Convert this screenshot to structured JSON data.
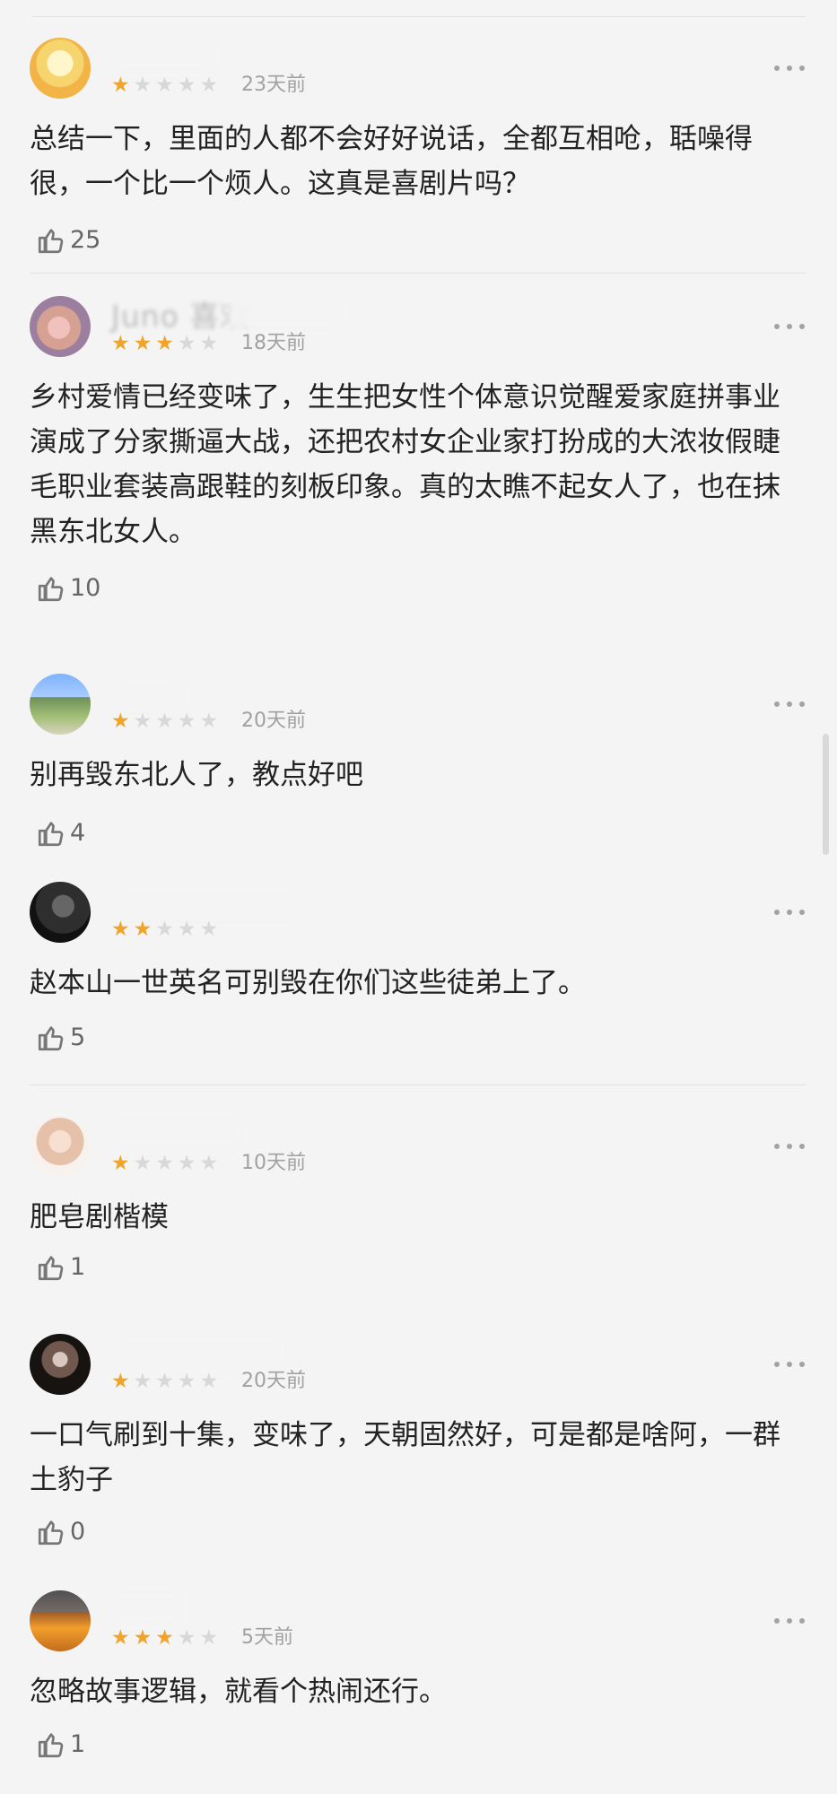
{
  "reviews": [
    {
      "name": "",
      "time": "23天前",
      "rating": 1,
      "text": "总结一下，里面的人都不会好好说话，全都互相呛，聒噪得很，一个比一个烦人。这真是喜剧片吗？",
      "likes": "25"
    },
    {
      "name": "Juno 喜欢",
      "time": "18天前",
      "rating": 3,
      "text": "乡村爱情已经变味了，生生把女性个体意识觉醒爱家庭拼事业演成了分家撕逼大战，还把农村女企业家打扮成的大浓妆假睫毛职业套装高跟鞋的刻板印象。真的太瞧不起女人了，也在抹黑东北女人。",
      "likes": "10"
    },
    {
      "name": "",
      "time": "20天前",
      "rating": 1,
      "text": "别再毁东北人了，教点好吧",
      "likes": "4"
    },
    {
      "name": "",
      "time": "",
      "rating": 2,
      "text": "赵本山一世英名可别毁在你们这些徒弟上了。",
      "likes": "5"
    },
    {
      "name": "",
      "time": "10天前",
      "rating": 1,
      "text": "肥皂剧楷模",
      "likes": "1"
    },
    {
      "name": "",
      "time": "20天前",
      "rating": 1,
      "text": "一口气刷到十集，变味了，天朝固然好，可是都是啥阿，一群土豹子",
      "likes": "0"
    },
    {
      "name": "",
      "time": "5天前",
      "rating": 3,
      "text": "忽略故事逻辑，就看个热闹还行。",
      "likes": "1"
    }
  ],
  "icons": {
    "star": "star-icon",
    "like": "thumbs-up-icon",
    "more": "more-icon"
  },
  "colors": {
    "background": "#f4f4f4",
    "star_active": "#f1a42a",
    "star_inactive": "#d8d8d8",
    "text": "#222222",
    "muted": "#a1a1a1"
  }
}
